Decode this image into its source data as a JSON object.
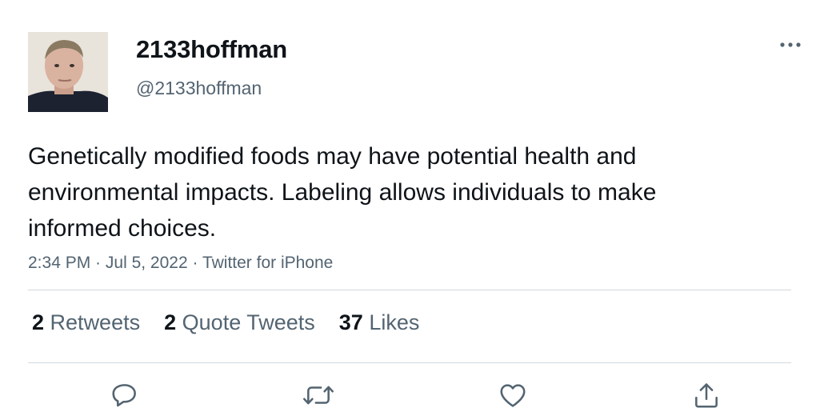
{
  "user": {
    "display_name": "2133hoffman",
    "handle": "@2133hoffman"
  },
  "tweet": {
    "text": "Genetically modified foods may have potential health and environmental impacts. Labeling allows individuals to make informed choices.",
    "time": "2:34 PM",
    "date": "Jul 5, 2022",
    "source": "Twitter for iPhone",
    "separator": " · "
  },
  "stats": {
    "retweets_count": "2",
    "retweets_label": "Retweets",
    "quote_count": "2",
    "quote_label": "Quote Tweets",
    "likes_count": "37",
    "likes_label": "Likes"
  },
  "icons": {
    "more": "more-horizontal-icon",
    "reply": "reply-icon",
    "retweet": "retweet-icon",
    "like": "heart-icon",
    "share": "share-icon"
  },
  "colors": {
    "text_primary": "#0f1419",
    "text_secondary": "#536471",
    "divider": "#cfd9de"
  }
}
